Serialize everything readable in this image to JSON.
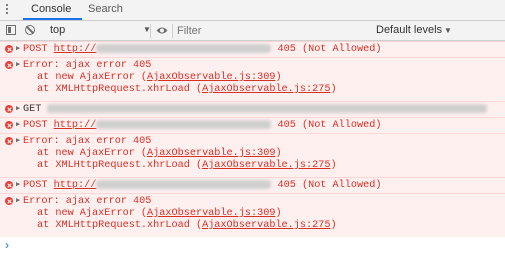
{
  "tabs": [
    {
      "label": "Console"
    },
    {
      "label": "Search"
    }
  ],
  "toolbar": {
    "context": "top",
    "filter_placeholder": "Filter",
    "levels_label": "Default levels"
  },
  "messages": [
    {
      "kind": "network",
      "method": "POST",
      "url": "http://",
      "status": "405 (Not Allowed)"
    },
    {
      "kind": "error",
      "title": "Error: ajax error 405",
      "trace": [
        {
          "prefix": "at new AjaxError (",
          "source": "AjaxObservable.js:309",
          "suffix": ")"
        },
        {
          "prefix": "at XMLHttpRequest.xhrLoad (",
          "source": "AjaxObservable.js:275",
          "suffix": ")"
        }
      ]
    },
    {
      "kind": "network",
      "method": "GET",
      "url": "",
      "status": ""
    },
    {
      "kind": "network",
      "method": "POST",
      "url": "http://",
      "status": "405 (Not Allowed)"
    },
    {
      "kind": "error",
      "title": "Error: ajax error 405",
      "trace": [
        {
          "prefix": "at new AjaxError (",
          "source": "AjaxObservable.js:309",
          "suffix": ")"
        },
        {
          "prefix": "at XMLHttpRequest.xhrLoad (",
          "source": "AjaxObservable.js:275",
          "suffix": ")"
        }
      ]
    },
    {
      "kind": "network",
      "method": "POST",
      "url": "http://",
      "status": "405 (Not Allowed)"
    },
    {
      "kind": "error",
      "title": "Error: ajax error 405",
      "trace": [
        {
          "prefix": "at new AjaxError (",
          "source": "AjaxObservable.js:309",
          "suffix": ")"
        },
        {
          "prefix": "at XMLHttpRequest.xhrLoad (",
          "source": "AjaxObservable.js:275",
          "suffix": ")"
        }
      ]
    }
  ],
  "colors": {
    "error_text": "#d93025",
    "error_bg": "#fff0f0",
    "accent": "#1a73e8"
  }
}
